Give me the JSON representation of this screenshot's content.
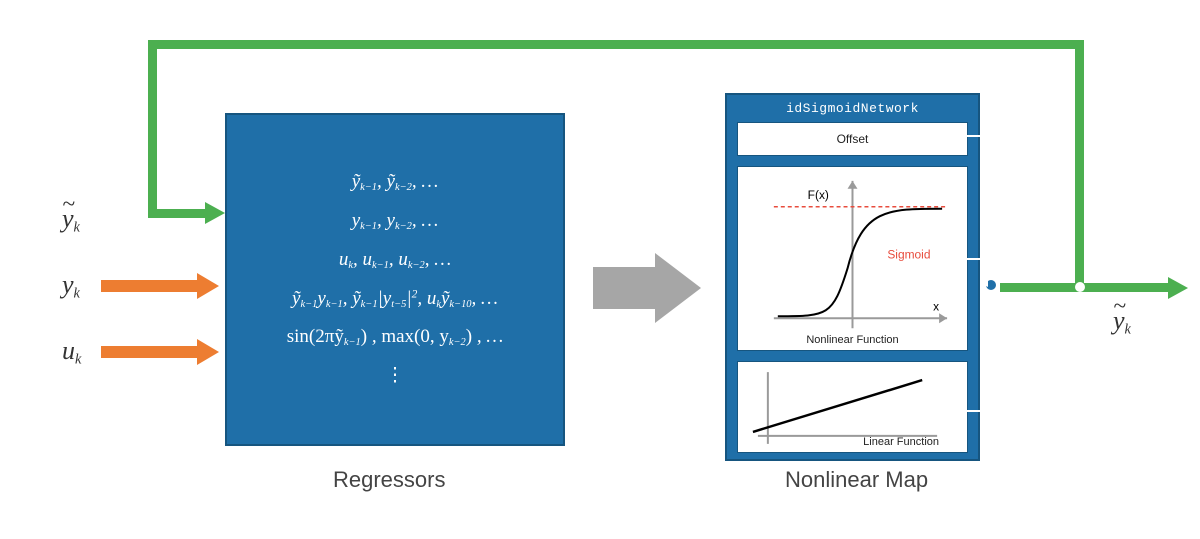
{
  "inputs": {
    "ytilde": "y",
    "ytilde_sub": "k",
    "y": "y",
    "y_sub": "k",
    "u": "u",
    "u_sub": "k"
  },
  "regressors": {
    "label": "Regressors",
    "line1_a": "ỹ",
    "line1_asub": "k−1",
    "line1_b": "ỹ",
    "line1_bsub": "k−2",
    "line2_a": "y",
    "line2_asub": "k−1",
    "line2_b": "y",
    "line2_bsub": "k−2",
    "line3_a": "u",
    "line3_asub": "k",
    "line3_b": "u",
    "line3_bsub": "k−1",
    "line3_c": "u",
    "line3_csub": "k−2",
    "line4_a1": "ỹ",
    "line4_a1sub": "k−1",
    "line4_a2": "y",
    "line4_a2sub": "k−1",
    "line4_b1": "ỹ",
    "line4_b1sub": "k−1",
    "line4_b2": "|y",
    "line4_b2sub": "t−5",
    "line4_b2sup": "2",
    "line4_c1": "u",
    "line4_c1sub": "k",
    "line4_c2": "ỹ",
    "line4_c2sub": "k−10",
    "line5_a": "sin(2πỹ",
    "line5_asub": "k−1",
    "line5_a_close": ")",
    "line5_b": "max(0, y",
    "line5_bsub": "k−2",
    "line5_b_close": ")",
    "ellipsis_v": "⋮",
    "ellipsis_h": "…"
  },
  "nlmap": {
    "label": "Nonlinear Map",
    "title": "idSigmoidNetwork",
    "offset": "Offset",
    "nonlin_title": "Nonlinear Function",
    "fx": "F(x)",
    "x": "x",
    "sigmoid": "Sigmoid",
    "linear_title": "Linear Function"
  },
  "output": {
    "ytilde": "y",
    "ytilde_sub": "k"
  }
}
